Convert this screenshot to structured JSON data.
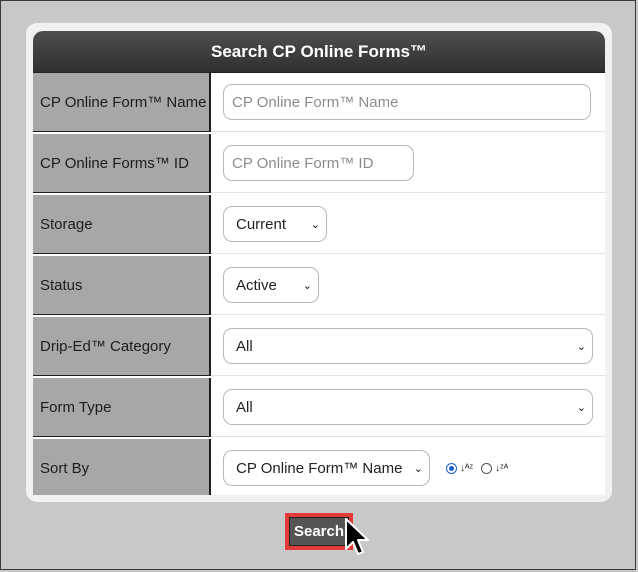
{
  "header": {
    "title": "Search CP Online Forms™"
  },
  "rows": [
    {
      "label": "CP Online Form™ Name",
      "placeholder": "CP Online Form™ Name"
    },
    {
      "label": "CP Online Forms™ ID",
      "placeholder": "CP Online Form™ ID"
    },
    {
      "label": "Storage",
      "selected": "Current"
    },
    {
      "label": "Status",
      "selected": "Active"
    },
    {
      "label": "Drip-Ed™ Category",
      "selected": "All"
    },
    {
      "label": "Form Type",
      "selected": "All"
    },
    {
      "label": "Sort By",
      "selected": "CP Online Form™ Name"
    }
  ],
  "sort": {
    "asc_icon": "sort-alpha-asc-icon",
    "desc_icon": "sort-alpha-desc-icon",
    "asc_glyph": "↓ᴬᶻ",
    "desc_glyph": "↓ᶻᴬ",
    "asc_selected": true
  },
  "search_button": {
    "label": "Search"
  },
  "colors": {
    "label_bg": "#a8a7a5",
    "header_bg": "#3a3a3a",
    "button_border": "#e33a3a",
    "button_bg": "#555555",
    "radio_on": "#1a5fd6"
  }
}
